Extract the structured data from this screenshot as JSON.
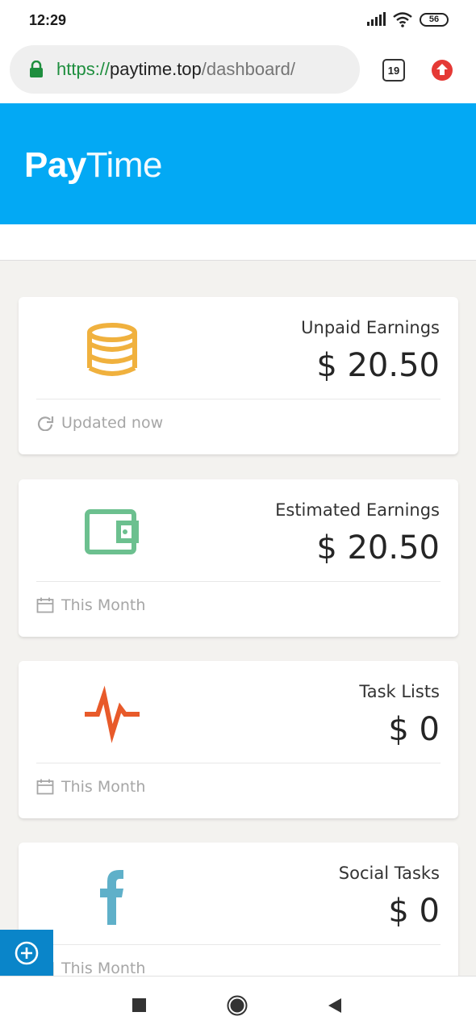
{
  "status_bar": {
    "time": "12:29",
    "battery": "56",
    "icons": [
      "signal-icon",
      "wifi-icon",
      "battery-icon"
    ]
  },
  "browser": {
    "url_scheme": "https://",
    "url_host": "paytime.top",
    "url_path": "/dashboard/",
    "tab_count": "19",
    "colors": {
      "lock": "#1e8e3e",
      "upload": "#e53935"
    }
  },
  "header": {
    "logo_bold": "Pay",
    "logo_light": "Time",
    "background": "#03a9f4"
  },
  "cards": [
    {
      "label": "Unpaid Earnings",
      "value": "$ 20.50",
      "footer": "Updated now",
      "icon": "coins-icon",
      "footer_icon": "refresh-icon",
      "icon_color": "#f0b13e"
    },
    {
      "label": "Estimated Earnings",
      "value": "$ 20.50",
      "footer": "This Month",
      "icon": "wallet-icon",
      "footer_icon": "calendar-icon",
      "icon_color": "#6cc08f"
    },
    {
      "label": "Task Lists",
      "value": "$ 0",
      "footer": "This Month",
      "icon": "pulse-icon",
      "footer_icon": "calendar-icon",
      "icon_color": "#e85a2a"
    },
    {
      "label": "Social Tasks",
      "value": "$ 0",
      "footer": "This Month",
      "icon": "facebook-icon",
      "footer_icon": "calendar-icon",
      "icon_color": "#5fb0c9"
    }
  ],
  "floating_button": {
    "icon": "plus-circle-icon",
    "color": "#0a85c9"
  },
  "nav_bar": {
    "icons": [
      "recents-square-icon",
      "home-circle-icon",
      "back-triangle-icon"
    ]
  }
}
